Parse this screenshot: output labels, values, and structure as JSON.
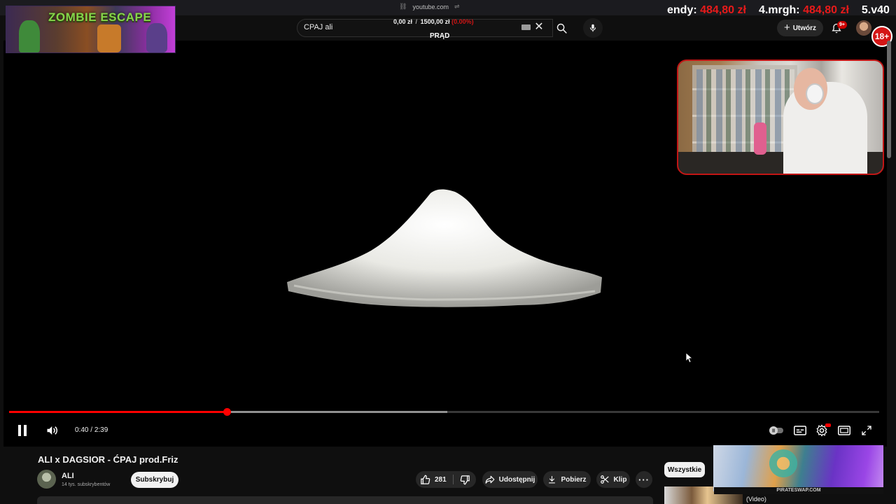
{
  "browser": {
    "url": "youtube.com"
  },
  "header": {
    "search_query": "CPAJ ali",
    "create_label": "Utwórz",
    "notifications_badge": "9+"
  },
  "stream_overlay": {
    "donation_current": "0,00 zł",
    "donation_separator": "/",
    "donation_goal": "1500,00 zł",
    "donation_percent": "(0.00%)",
    "goal_label": "PRĄD",
    "ticker_1_name": "endy:",
    "ticker_1_amount": "484,80 zł",
    "ticker_2_name": "4.mrgh:",
    "ticker_2_amount": "484,80 zł",
    "ticker_3_name": "5.v40",
    "game_logo_text": "ZOMBIE ESCAPE",
    "age_badge": "18+"
  },
  "player": {
    "current_time": "0:40",
    "duration": "2:39",
    "time_separator": " / ",
    "progress_played_fraction": 0.25,
    "progress_buffered_fraction": 0.504
  },
  "video": {
    "title": "ALI x DAGSIOR - ĆPAJ prod.Friz",
    "channel_name": "ALI",
    "subscriber_count": "14 tys. subskrybentów",
    "subscribe_label": "Subskrybuj",
    "like_count": "281",
    "share_label": "Udostępnij",
    "download_label": "Pobierz",
    "clip_label": "Klip"
  },
  "sidebar": {
    "chip_all_label": "Wszystkie",
    "ad_label": "PIRATESWAP.COM",
    "next_video_title_fragment": "(Video)"
  },
  "colors": {
    "progress": "#ff0000",
    "accent_red": "#e81a1a",
    "background": "#0f0f0f"
  }
}
